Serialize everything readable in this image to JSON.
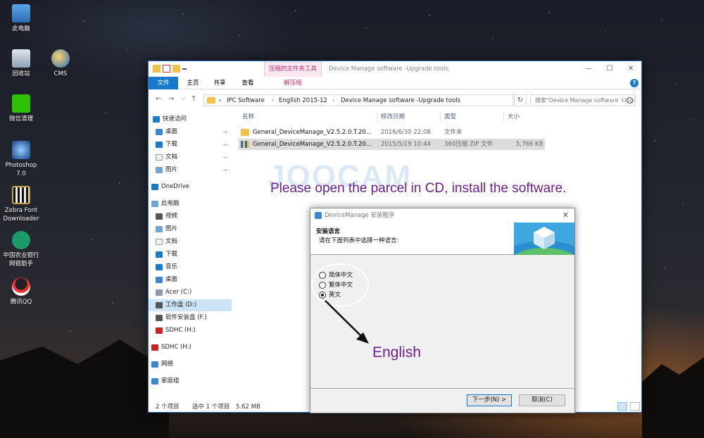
{
  "desktop": {
    "icons": [
      {
        "label": "此电脑"
      },
      {
        "label": "回收站"
      },
      {
        "label": "CMS"
      },
      {
        "label": "微信清理"
      },
      {
        "label": "Photoshop 7.0"
      },
      {
        "label": "Zebra Font Downloader"
      },
      {
        "label": "中国农业银行 网银助手"
      },
      {
        "label": "腾讯QQ"
      }
    ]
  },
  "explorer": {
    "title": "Device Manage software -Upgrade tools",
    "context_tab_group": "压缩的文件夹工具",
    "ribbon_tabs": [
      "文件",
      "主页",
      "共享",
      "查看",
      "解压缩"
    ],
    "window_buttons": {
      "minimize": "—",
      "maximize": "☐",
      "close": "✕"
    },
    "address": {
      "prefix": "«",
      "crumbs": [
        "IPC Software",
        "English 2015-12",
        "Device Manage software -Upgrade tools"
      ],
      "separator": "›",
      "dropdown": "⌵",
      "refresh": "↻"
    },
    "search": {
      "placeholder": "搜索\"Device Manage software -Upgrade tools\""
    },
    "nav_arrows": {
      "back": "←",
      "forward": "→",
      "history": "⌵",
      "up": "↑"
    },
    "nav_pane": [
      {
        "label": "快速访问",
        "pinned": false
      },
      {
        "label": "桌面",
        "pinned": true
      },
      {
        "label": "下载",
        "pinned": true
      },
      {
        "label": "文档",
        "pinned": true
      },
      {
        "label": "图片",
        "pinned": true
      },
      {
        "label": "OneDrive",
        "pinned": false
      },
      {
        "label": "此电脑",
        "pinned": false
      },
      {
        "label": "视频",
        "pinned": false
      },
      {
        "label": "图片",
        "pinned": false
      },
      {
        "label": "文档",
        "pinned": false
      },
      {
        "label": "下载",
        "pinned": false
      },
      {
        "label": "音乐",
        "pinned": false
      },
      {
        "label": "桌面",
        "pinned": false
      },
      {
        "label": "Acer (C:)",
        "pinned": false
      },
      {
        "label": "工作盘 (D:)",
        "pinned": false,
        "selected": true
      },
      {
        "label": "软件安装盘 (F:)",
        "pinned": false
      },
      {
        "label": "SDHC (H:)",
        "pinned": false
      },
      {
        "label": "SDHC (H:)",
        "pinned": false
      },
      {
        "label": "网络",
        "pinned": false
      },
      {
        "label": "家庭组",
        "pinned": false
      }
    ],
    "pin_glyph": "📌",
    "columns": [
      "名称",
      "修改日期",
      "类型",
      "大小"
    ],
    "files": [
      {
        "name": "General_DeviceManage_V2.5.2.0.T.20...",
        "modified": "2016/6/30 22:08",
        "type": "文件夹",
        "size": ""
      },
      {
        "name": "General_DeviceManage_V2.5.2.0.T.20...",
        "modified": "2015/5/19 10:44",
        "type": "360压缩 ZIP 文件",
        "size": "5,766 KB",
        "selected": true
      }
    ],
    "status": {
      "items": "2 个项目",
      "selected": "选中 1 个项目",
      "size": "5.62 MB"
    },
    "help_glyph": "?"
  },
  "installer": {
    "title": "DeviceManage 安装程序",
    "close": "✕",
    "heading": "安装语言",
    "subheading": "请在下面列表中选择一种语言:",
    "languages": [
      {
        "label": "简体中文",
        "checked": false
      },
      {
        "label": "繁体中文",
        "checked": false
      },
      {
        "label": "英文",
        "checked": true
      }
    ],
    "next_button": "下一步(N) >",
    "cancel_button": "取消(C)"
  },
  "annotations": {
    "watermark": "JOOCAM",
    "instruction": "Please open the parcel in CD, install the software.",
    "english": "English",
    "color": "#6b1e8c"
  }
}
